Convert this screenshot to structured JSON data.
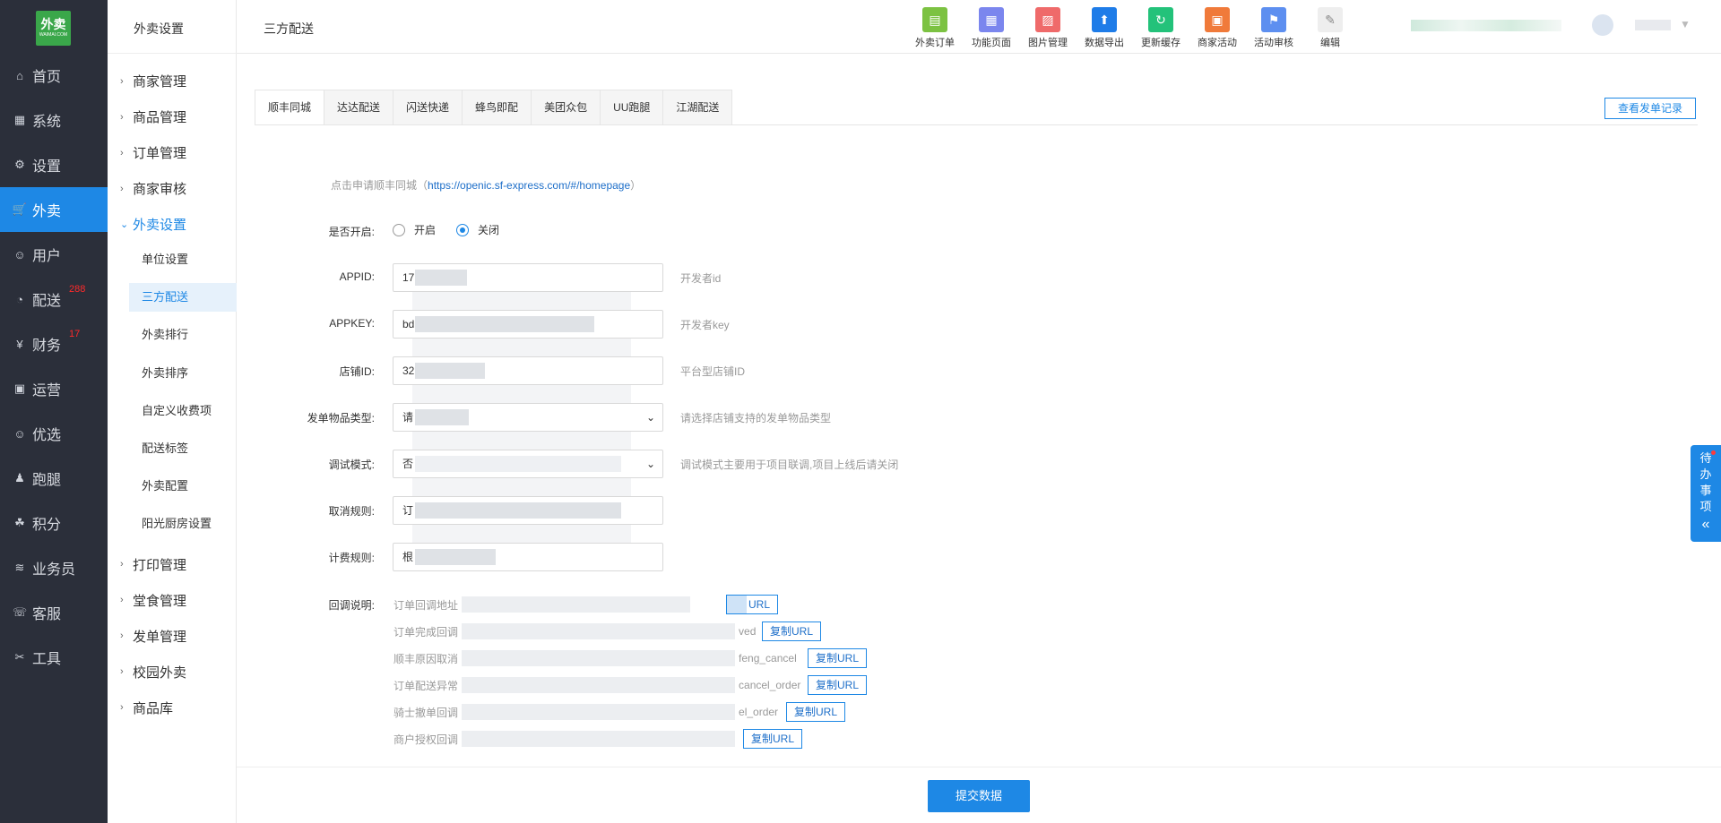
{
  "logo": {
    "text": "外卖",
    "sub": "WAIMAI.COM"
  },
  "mainnav": [
    {
      "label": "首页",
      "icon": "home-icon",
      "glyph": "⌂",
      "badge": ""
    },
    {
      "label": "系统",
      "icon": "windows-icon",
      "glyph": "▦",
      "badge": ""
    },
    {
      "label": "设置",
      "icon": "gear-icon",
      "glyph": "⚙",
      "badge": ""
    },
    {
      "label": "外卖",
      "icon": "cart-icon",
      "glyph": "🛒",
      "badge": ""
    },
    {
      "label": "用户",
      "icon": "user-icon",
      "glyph": "☺",
      "badge": ""
    },
    {
      "label": "配送",
      "icon": "dashboard-icon",
      "glyph": "◔",
      "badge": "288"
    },
    {
      "label": "财务",
      "icon": "yen-icon",
      "glyph": "¥",
      "badge": "17"
    },
    {
      "label": "运营",
      "icon": "gift-icon",
      "glyph": "▣",
      "badge": ""
    },
    {
      "label": "优选",
      "icon": "smile-icon",
      "glyph": "☺",
      "badge": ""
    },
    {
      "label": "跑腿",
      "icon": "person-icon",
      "glyph": "♟",
      "badge": ""
    },
    {
      "label": "积分",
      "icon": "points-icon",
      "glyph": "☘",
      "badge": ""
    },
    {
      "label": "业务员",
      "icon": "layers-icon",
      "glyph": "≋",
      "badge": ""
    },
    {
      "label": "客服",
      "icon": "headset-icon",
      "glyph": "☏",
      "badge": ""
    },
    {
      "label": "工具",
      "icon": "tools-icon",
      "glyph": "✂",
      "badge": ""
    }
  ],
  "subnav": {
    "title": "外卖设置",
    "groups_top": [
      "商家管理",
      "商品管理",
      "订单管理",
      "商家审核"
    ],
    "open_group": "外卖设置",
    "items": [
      "单位设置",
      "三方配送",
      "外卖排行",
      "外卖排序",
      "自定义收费项",
      "配送标签",
      "外卖配置",
      "阳光厨房设置"
    ],
    "groups_bottom": [
      "打印管理",
      "堂食管理",
      "发单管理",
      "校园外卖",
      "商品库"
    ]
  },
  "header": {
    "page_title": "三方配送",
    "tools": [
      {
        "label": "外卖订单",
        "icon": "order-icon",
        "color": "#7cc242",
        "glyph": "▤"
      },
      {
        "label": "功能页面",
        "icon": "grid-icon",
        "color": "#7b86ee",
        "glyph": "▦"
      },
      {
        "label": "图片管理",
        "icon": "image-icon",
        "color": "#ef6a6a",
        "glyph": "▨"
      },
      {
        "label": "数据导出",
        "icon": "upload-icon",
        "color": "#1e7ce8",
        "glyph": "⬆"
      },
      {
        "label": "更新缓存",
        "icon": "refresh-icon",
        "color": "#23c27a",
        "glyph": "↻"
      },
      {
        "label": "商家活动",
        "icon": "gift-icon",
        "color": "#f07a3a",
        "glyph": "▣"
      },
      {
        "label": "活动审核",
        "icon": "flag-icon",
        "color": "#5d8ff0",
        "glyph": "⚑"
      },
      {
        "label": "编辑",
        "icon": "pen-icon",
        "color": "#eeeeee",
        "glyph": "✎"
      }
    ]
  },
  "tabs": [
    "顺丰同城",
    "达达配送",
    "闪送快递",
    "蜂鸟即配",
    "美团众包",
    "UU跑腿",
    "江湖配送"
  ],
  "record_button": "查看发单记录",
  "hint": {
    "prefix": "点击申请顺丰同城（",
    "link": "https://openic.sf-express.com/#/homepage",
    "suffix": "）"
  },
  "form": {
    "enable_label": "是否开启:",
    "enable_on": "开启",
    "enable_off": "关闭",
    "appid_label": "APPID:",
    "appid_value": "17",
    "appid_help": "开发者id",
    "appkey_label": "APPKEY:",
    "appkey_value": "bd",
    "appkey_help": "开发者key",
    "shop_label": "店铺ID:",
    "shop_value": "32",
    "shop_help": "平台型店铺ID",
    "goods_label": "发单物品类型:",
    "goods_value": "请",
    "goods_help": "请选择店铺支持的发单物品类型",
    "debug_label": "调试模式:",
    "debug_value": "否",
    "debug_help": "调试模式主要用于项目联调,项目上线后请关闭",
    "cancel_label": "取消规则:",
    "cancel_value": "订",
    "fee_label": "计费规则:",
    "fee_value": "根"
  },
  "callback": {
    "label": "回调说明:",
    "rows": [
      {
        "prefix": "订单回调地址",
        "suffix": "",
        "button": "URL"
      },
      {
        "prefix": "订单完成回调",
        "suffix": "ved",
        "button": "复制URL"
      },
      {
        "prefix": "顺丰原因取消",
        "suffix": "feng_cancel",
        "button": "复制URL"
      },
      {
        "prefix": "订单配送异常",
        "suffix": "cancel_order",
        "button": "复制URL"
      },
      {
        "prefix": "骑士撤单回调",
        "suffix": "el_order",
        "button": "复制URL"
      },
      {
        "prefix": "商户授权回调",
        "suffix": "",
        "button": "复制URL"
      }
    ]
  },
  "submit_label": "提交数据",
  "todo": {
    "text": "待办事项",
    "arrow": "«"
  },
  "colors": {
    "accent": "#1e88e5",
    "sidebar": "#2b2f3a",
    "badge": "#ff2a2a"
  }
}
